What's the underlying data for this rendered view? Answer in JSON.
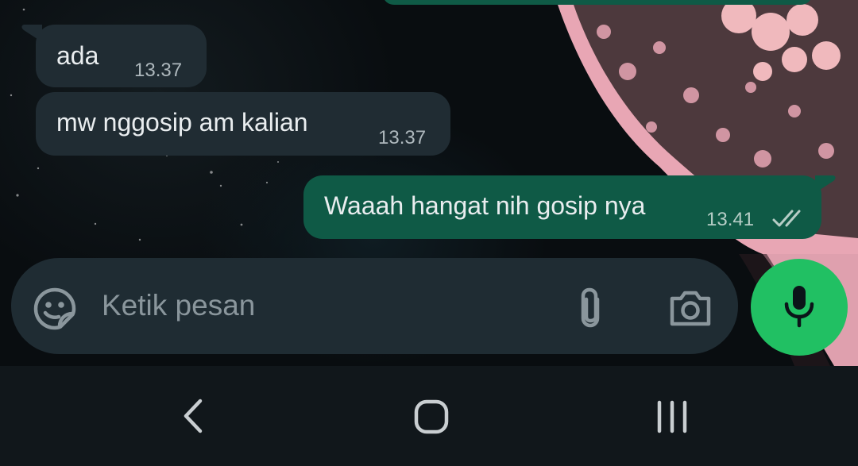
{
  "messages": [
    {
      "direction": "incoming",
      "text": "ada",
      "time": "13.37"
    },
    {
      "direction": "incoming",
      "text": "mw nggosip am kalian",
      "time": "13.37"
    },
    {
      "direction": "outgoing",
      "text": "Waaah hangat nih gosip nya",
      "time": "13.41",
      "status": "read"
    }
  ],
  "composer": {
    "placeholder": "Ketik pesan",
    "sticker_icon": "sticker-icon",
    "attach_icon": "paperclip-icon",
    "camera_icon": "camera-icon",
    "mic_icon": "microphone-icon"
  },
  "navbar": {
    "back_icon": "back-chevron-icon",
    "home_icon": "home-icon",
    "recents_icon": "recent-apps-icon"
  },
  "colors": {
    "incoming_bubble": "#202c33",
    "outgoing_bubble": "#0f5a46",
    "mic_button": "#21c063",
    "composer": "#1f2c33",
    "navbar": "#11171b"
  }
}
